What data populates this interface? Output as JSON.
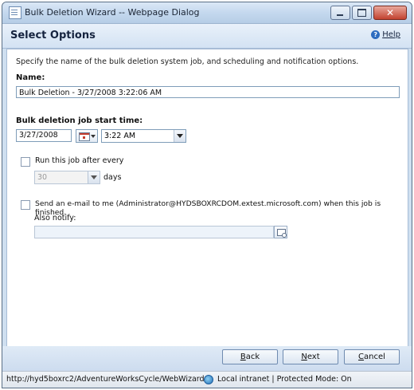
{
  "window": {
    "title": "Bulk Deletion Wizard -- Webpage Dialog",
    "controls": {
      "minimize": "minimize",
      "maximize": "maximize",
      "close": "✕"
    }
  },
  "header": {
    "title": "Select Options",
    "help_label": "Help",
    "help_icon": "?"
  },
  "form": {
    "description": "Specify the name of the bulk deletion system job, and scheduling and notification options.",
    "name_label": "Name:",
    "name_value": "Bulk Deletion - 3/27/2008 3:22:06 AM",
    "start_time_label": "Bulk deletion job start time:",
    "date_value": "3/27/2008",
    "time_value": "3:22 AM",
    "run_every_label": "Run this job after every",
    "run_every_checked": false,
    "interval_value": "30",
    "interval_unit": "days",
    "email_label": "Send an e-mail to me (Administrator@HYDSBOXRCDOM.extest.microsoft.com) when this job is finished.",
    "email_checked": false,
    "also_notify_label": "Also notify:",
    "also_notify_value": ""
  },
  "footer": {
    "back_label": "Back",
    "back_mnemonic": "B",
    "back_rest": "ack",
    "next_label": "Next",
    "next_mnemonic": "N",
    "next_rest": "ext",
    "cancel_label": "Cancel",
    "cancel_mnemonic": "C",
    "cancel_rest": "ancel"
  },
  "statusbar": {
    "url": "http://hyd5boxrc2/AdventureWorksCycle/WebWizard/",
    "zone": "Local intranet | Protected Mode: On"
  }
}
